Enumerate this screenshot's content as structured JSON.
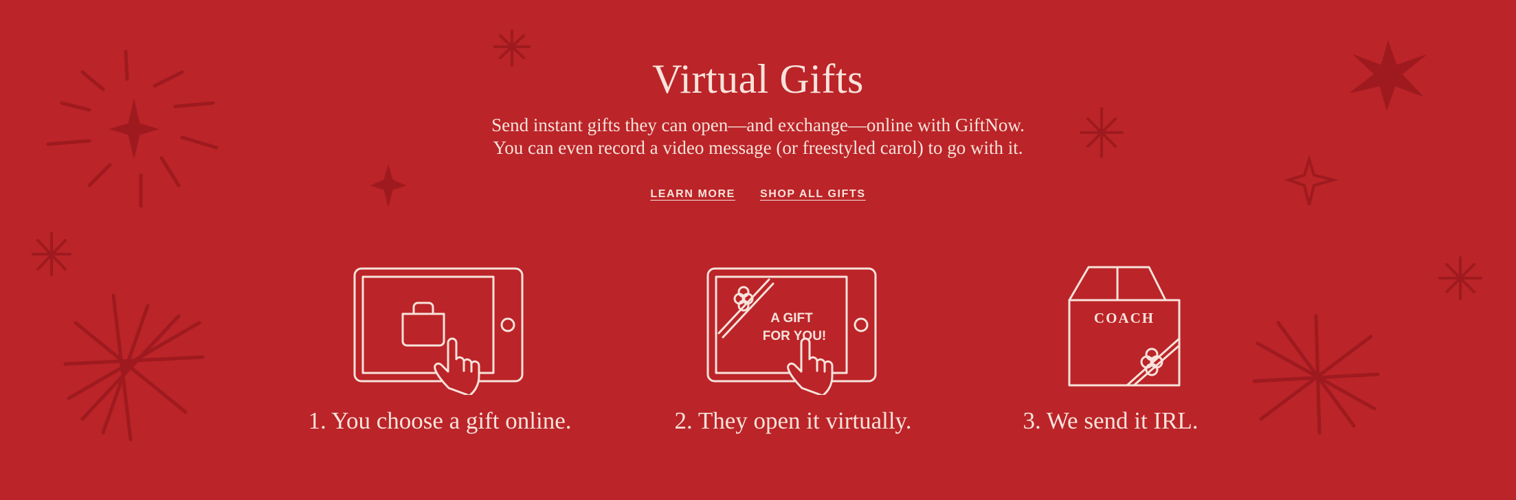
{
  "header": {
    "title": "Virtual Gifts",
    "subtitle_line1": "Send instant gifts they can open—and exchange—online with GiftNow.",
    "subtitle_line2": "You can even record a video message (or freestyled carol) to go with it."
  },
  "links": {
    "learn_more": "LEARN MORE",
    "shop_all_gifts": "SHOP ALL GIFTS"
  },
  "steps": [
    {
      "label": "1. You choose a gift online.",
      "icon": "tablet-bag-tap-icon"
    },
    {
      "label": "2. They open it virtually.",
      "icon": "tablet-gift-message-icon",
      "screen_text_line1": "A GIFT",
      "screen_text_line2": "FOR YOU!"
    },
    {
      "label": "3. We send it IRL.",
      "icon": "coach-box-icon",
      "box_brand": "COACH"
    }
  ],
  "colors": {
    "background": "#bb2428",
    "foreground": "#f7e3dc",
    "decoration": "#9e1a1f"
  }
}
